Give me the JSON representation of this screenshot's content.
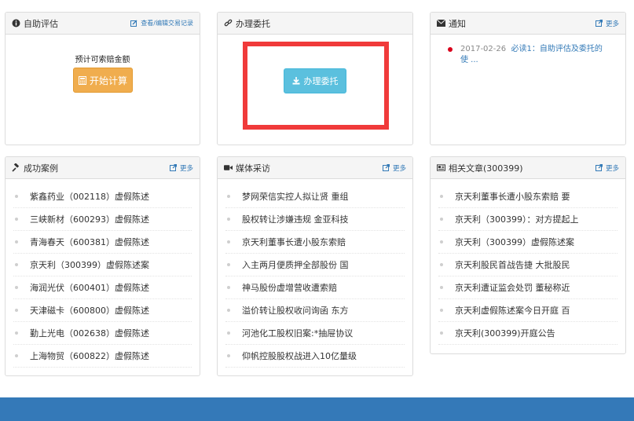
{
  "self_eval": {
    "title": "自助评估",
    "link": "查看/编辑交易记录",
    "estimate_label": "预计可索赔金额",
    "calc_button": "开始计算"
  },
  "entrust": {
    "title": "办理委托",
    "button": "办理委托"
  },
  "notice": {
    "title": "通知",
    "more": "更多",
    "items": [
      {
        "date": "2017-02-26",
        "text": "必读1：自助评估及委托的使 ..."
      }
    ]
  },
  "cases": {
    "title": "成功案例",
    "more": "更多",
    "items": [
      "紫鑫药业（002118）虚假陈述",
      "三峡新材（600293）虚假陈述",
      "青海春天（600381）虚假陈述",
      "京天利（300399）虚假陈述案",
      "海润光伏（600401）虚假陈述",
      "天津磁卡（600800）虚假陈述",
      "勤上光电（002638）虚假陈述",
      "上海物贸（600822）虚假陈述"
    ]
  },
  "media": {
    "title": "媒体采访",
    "more": "更多",
    "items": [
      "梦网荣信实控人拟让贤 重组",
      "股权转让涉嫌违规 金亚科技",
      "京天利董事长遭小股东索赔",
      "入主两月便质押全部股份 国",
      "神马股份虚增营收遭索赔",
      "溢价转让股权收问询函 东方",
      "河池化工股权旧案:*抽屉协议",
      "仰帆控股股权战进入10亿量级"
    ]
  },
  "articles": {
    "title": "相关文章(300399)",
    "more": "更多",
    "items": [
      "京天利董事长遭小股东索赔 要",
      "京天利（300399）：对方提起上",
      "京天利（300399）虚假陈述案",
      "京天利股民首战告捷 大批股民",
      "京天利遭证监会处罚 董秘称近",
      "京天利虚假陈述案今日开庭 百",
      "京天利(300399)开庭公告"
    ]
  },
  "icons": {
    "self_eval": "info-circle-icon",
    "entrust": "link-icon",
    "notice": "envelope-icon",
    "cases": "gavel-icon",
    "media": "video-camera-icon",
    "articles": "newspaper-icon",
    "more": "external-link-icon",
    "edit": "edit-icon",
    "calc": "calculator-icon",
    "download": "download-icon"
  },
  "colors": {
    "accent_orange": "#f0ad4e",
    "accent_blue": "#5bc0de",
    "highlight_red": "#f03a3a",
    "link_blue": "#337ab7",
    "footer_blue": "#3479b8"
  }
}
